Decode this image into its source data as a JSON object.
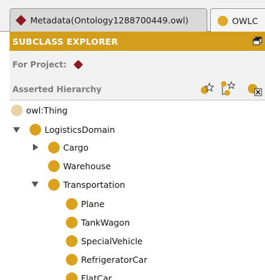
{
  "tabs": [
    {
      "label": "Metadata(Ontology1288700449.owl)",
      "icon": "ontology-diamond-icon",
      "active": false
    },
    {
      "label": "OWLC",
      "icon": "class-dot-icon",
      "active": true
    }
  ],
  "panel": {
    "title": "SUBCLASS EXPLORER",
    "for_project_label": "For Project:",
    "hierarchy_label": "Asserted Hierarchy",
    "tools": [
      "add-subclass-icon",
      "add-sibling-icon",
      "delete-class-icon"
    ]
  },
  "tree": {
    "root": {
      "label": "owl:Thing"
    },
    "items": [
      {
        "label": "LogisticsDomain",
        "expanded": true
      },
      {
        "label": "Cargo",
        "expanded": false
      },
      {
        "label": "Warehouse"
      },
      {
        "label": "Transportation",
        "expanded": true
      },
      {
        "label": "Plane"
      },
      {
        "label": "TankWagon"
      },
      {
        "label": "SpecialVehicle"
      },
      {
        "label": "RefrigeratorCar"
      },
      {
        "label": "FlatCar"
      }
    ]
  },
  "colors": {
    "header": "#d29e1c",
    "class_icon": "#d9a11c",
    "thing_icon": "#e8d3a6",
    "project_icon": "#8b1a24"
  }
}
